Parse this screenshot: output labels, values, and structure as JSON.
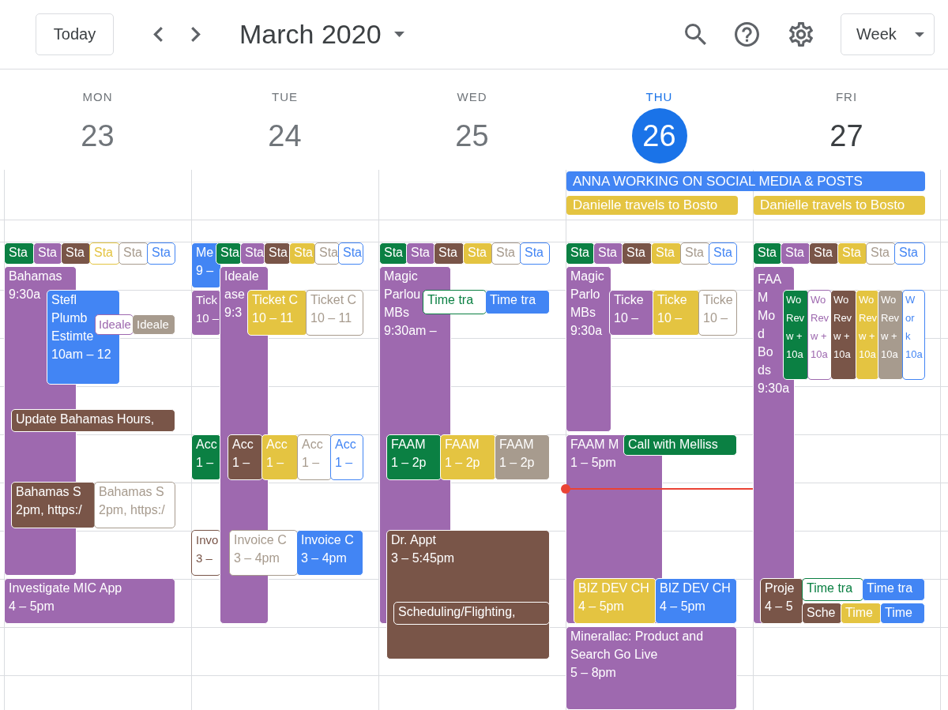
{
  "toolbar": {
    "today_button": "Today",
    "title": "March 2020",
    "view_button": "Week"
  },
  "days": [
    {
      "weekday": "MON",
      "date": "23",
      "past": true,
      "today": false,
      "events": [
        {
          "title": "Sta",
          "color": "#0b8043",
          "kind": "filled"
        },
        {
          "title": "Sta",
          "color": "#9e69af",
          "kind": "filled"
        },
        {
          "title": "Sta",
          "color": "#795548",
          "kind": "filled"
        },
        {
          "title": "Sta",
          "color": "#e4c441",
          "kind": "outlined"
        },
        {
          "title": "Sta",
          "color": "#a79b8e",
          "kind": "outlined"
        },
        {
          "title": "Sta",
          "color": "#4285f4",
          "kind": "outlined"
        },
        {
          "title": "Bahamas",
          "time": "9:30a",
          "color": "#9e69af",
          "kind": "filled"
        },
        {
          "title": "Stefl Plumb Estimte",
          "time": "10am – 12",
          "color": "#4285f4",
          "kind": "filled"
        },
        {
          "title": "Ideale",
          "color": "#9e69af",
          "kind": "outlined"
        },
        {
          "title": "Ideale",
          "color": "#a79b8e",
          "kind": "filled"
        },
        {
          "title": "Update Bahamas Hours,",
          "color": "#795548",
          "kind": "filled"
        },
        {
          "title": "Bahamas S",
          "time": "2pm, https:/",
          "color": "#795548",
          "kind": "filled"
        },
        {
          "title": "Bahamas S",
          "time": "2pm, https:/",
          "color": "#a79b8e",
          "kind": "outlined"
        },
        {
          "title": "Investigate MIC App",
          "time": "4 – 5pm",
          "color": "#9e69af",
          "kind": "filled"
        }
      ]
    },
    {
      "weekday": "TUE",
      "date": "24",
      "past": true,
      "today": false,
      "events": [
        {
          "title": "Me",
          "time": "9 –",
          "color": "#4285f4",
          "kind": "filled"
        },
        {
          "title": "Sta",
          "color": "#0b8043",
          "kind": "filled"
        },
        {
          "title": "Sta",
          "color": "#9e69af",
          "kind": "filled"
        },
        {
          "title": "Sta",
          "color": "#795548",
          "kind": "filled"
        },
        {
          "title": "Sta",
          "color": "#e4c441",
          "kind": "filled"
        },
        {
          "title": "Sta",
          "color": "#a79b8e",
          "kind": "outlined"
        },
        {
          "title": "Sta",
          "color": "#4285f4",
          "kind": "outlined"
        },
        {
          "title": "Tick",
          "time": "10 –",
          "color": "#9e69af",
          "kind": "filled"
        },
        {
          "title": "Ideale ase",
          "time": "9:3",
          "color": "#9e69af",
          "kind": "filled"
        },
        {
          "title": "Ticket C",
          "time": "10 – 11",
          "color": "#e4c441",
          "kind": "filled"
        },
        {
          "title": "Ticket C",
          "time": "10 – 11",
          "color": "#a79b8e",
          "kind": "outlined"
        },
        {
          "title": "Acc",
          "time": "1 –",
          "color": "#0b8043",
          "kind": "filled"
        },
        {
          "title": "Acc",
          "time": "1 –",
          "color": "#795548",
          "kind": "filled"
        },
        {
          "title": "Acc",
          "time": "1 –",
          "color": "#e4c441",
          "kind": "filled"
        },
        {
          "title": "Acc",
          "time": "1 –",
          "color": "#a79b8e",
          "kind": "outlined"
        },
        {
          "title": "Acc",
          "time": "1 –",
          "color": "#4285f4",
          "kind": "outlined"
        },
        {
          "title": "Invo",
          "time": "3 –",
          "color": "#795548",
          "kind": "outlined"
        },
        {
          "title": "Invoice C",
          "time": "3 – 4pm",
          "color": "#a79b8e",
          "kind": "outlined"
        },
        {
          "title": "Invoice C",
          "time": "3 – 4pm",
          "color": "#4285f4",
          "kind": "filled"
        }
      ]
    },
    {
      "weekday": "WED",
      "date": "25",
      "past": true,
      "today": false,
      "events": [
        {
          "title": "Sta",
          "color": "#0b8043",
          "kind": "filled"
        },
        {
          "title": "Sta",
          "color": "#9e69af",
          "kind": "filled"
        },
        {
          "title": "Sta",
          "color": "#795548",
          "kind": "filled"
        },
        {
          "title": "Sta",
          "color": "#e4c441",
          "kind": "filled"
        },
        {
          "title": "Sta",
          "color": "#a79b8e",
          "kind": "outlined"
        },
        {
          "title": "Sta",
          "color": "#4285f4",
          "kind": "outlined"
        },
        {
          "title": "Magic Parlou MBs",
          "time": "9:30am –",
          "color": "#9e69af",
          "kind": "filled"
        },
        {
          "title": "Time tra",
          "color": "#0b8043",
          "kind": "outlined"
        },
        {
          "title": "Time tra",
          "color": "#4285f4",
          "kind": "filled"
        },
        {
          "title": "FAAM",
          "time": "1 – 2p",
          "color": "#0b8043",
          "kind": "filled"
        },
        {
          "title": "FAAM",
          "time": "1 – 2p",
          "color": "#e4c441",
          "kind": "filled"
        },
        {
          "title": "FAAM",
          "time": "1 – 2p",
          "color": "#a79b8e",
          "kind": "filled"
        },
        {
          "title": "Dr. Appt",
          "time": "3 – 5:45pm",
          "color": "#795548",
          "kind": "filled"
        },
        {
          "title": "Scheduling/Flighting,",
          "color": "#795548",
          "kind": "filled"
        }
      ]
    },
    {
      "weekday": "THU",
      "date": "26",
      "past": false,
      "today": true,
      "events": [
        {
          "title": "Sta",
          "color": "#0b8043",
          "kind": "filled"
        },
        {
          "title": "Sta",
          "color": "#9e69af",
          "kind": "filled"
        },
        {
          "title": "Sta",
          "color": "#795548",
          "kind": "filled"
        },
        {
          "title": "Sta",
          "color": "#e4c441",
          "kind": "filled"
        },
        {
          "title": "Sta",
          "color": "#a79b8e",
          "kind": "outlined"
        },
        {
          "title": "Sta",
          "color": "#4285f4",
          "kind": "outlined"
        },
        {
          "title": "Magic Parlo MBs",
          "time": "9:30a",
          "color": "#9e69af",
          "kind": "filled"
        },
        {
          "title": "Ticke",
          "time": "10 –",
          "color": "#9e69af",
          "kind": "filled"
        },
        {
          "title": "Ticke",
          "time": "10 –",
          "color": "#e4c441",
          "kind": "filled"
        },
        {
          "title": "Ticke",
          "time": "10 –",
          "color": "#a79b8e",
          "kind": "outlined"
        },
        {
          "title": "FAAM M",
          "time": "1 – 5pm",
          "color": "#9e69af",
          "kind": "filled"
        },
        {
          "title": "Call with Melliss",
          "color": "#0b8043",
          "kind": "filled"
        },
        {
          "title": "BIZ DEV CH",
          "time": "4 – 5pm",
          "color": "#e4c441",
          "kind": "filled"
        },
        {
          "title": "BIZ DEV CH",
          "time": "4 – 5pm",
          "color": "#4285f4",
          "kind": "filled"
        },
        {
          "title": "Minerallac: Product and Search Go Live",
          "time": "5 – 8pm",
          "color": "#9e69af",
          "kind": "filled"
        }
      ]
    },
    {
      "weekday": "FRI",
      "date": "27",
      "past": false,
      "today": false,
      "events": [
        {
          "title": "Sta",
          "color": "#0b8043",
          "kind": "filled"
        },
        {
          "title": "Sta",
          "color": "#9e69af",
          "kind": "filled"
        },
        {
          "title": "Sta",
          "color": "#795548",
          "kind": "filled"
        },
        {
          "title": "Sta",
          "color": "#e4c441",
          "kind": "filled"
        },
        {
          "title": "Sta",
          "color": "#a79b8e",
          "kind": "outlined"
        },
        {
          "title": "Sta",
          "color": "#4285f4",
          "kind": "outlined"
        },
        {
          "title": "FAAM Mo d Bo ds",
          "time": "9:30a",
          "color": "#9e69af",
          "kind": "filled"
        },
        {
          "title": "Wo Rev w +",
          "time": "10a",
          "color": "#0b8043",
          "kind": "filled"
        },
        {
          "title": "Wo Rev w +",
          "time": "10a",
          "color": "#9e69af",
          "kind": "outlined"
        },
        {
          "title": "Wo Rev w +",
          "time": "10a",
          "color": "#795548",
          "kind": "filled"
        },
        {
          "title": "Wo Rev w +",
          "time": "10a",
          "color": "#e4c441",
          "kind": "filled"
        },
        {
          "title": "Wo Rev w +",
          "time": "10a",
          "color": "#a79b8e",
          "kind": "filled"
        },
        {
          "title": "Work",
          "time": "10a",
          "color": "#4285f4",
          "kind": "outlined"
        },
        {
          "title": "Proje",
          "time": "4 – 5",
          "color": "#795548",
          "kind": "filled"
        },
        {
          "title": "Time tra",
          "color": "#0b8043",
          "kind": "outlined"
        },
        {
          "title": "Time tra",
          "color": "#4285f4",
          "kind": "filled"
        },
        {
          "title": "Sche",
          "color": "#795548",
          "kind": "filled"
        },
        {
          "title": "Time",
          "color": "#e4c441",
          "kind": "filled"
        },
        {
          "title": "Time",
          "color": "#4285f4",
          "kind": "filled"
        }
      ]
    }
  ],
  "all_day_events": [
    {
      "title": "ANNA WORKING ON SOCIAL MEDIA & POSTS",
      "color": "#4285f4"
    },
    {
      "title": "Danielle travels to Bosto",
      "color": "#e4c441"
    },
    {
      "title": "Danielle travels to Bosto",
      "color": "#e4c441"
    }
  ]
}
